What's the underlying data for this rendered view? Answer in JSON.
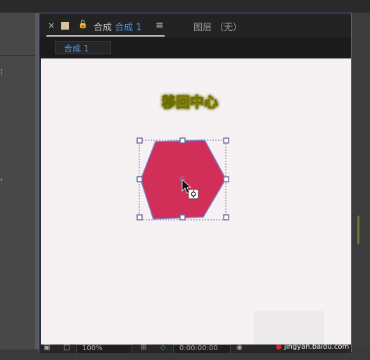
{
  "tabbar": {
    "close_glyph": "×",
    "lock_glyph": "🔓",
    "composition_prefix": "合成",
    "composition_name": "合成 1",
    "menu_glyph": "≡",
    "layer_label": "图层 （无）"
  },
  "comp_chip": "合成 1",
  "canvas": {
    "annotation": "移回中心",
    "annotation_color": "#f4e800",
    "shape_fill": "#d12e58",
    "shape_stroke": "#7f7fc8",
    "handle_color": "#6b6f9a"
  },
  "viewerbar": {
    "zoom": "100%",
    "timecode": "0:00:00:00"
  },
  "watermark": "jingyan.baidu.com"
}
